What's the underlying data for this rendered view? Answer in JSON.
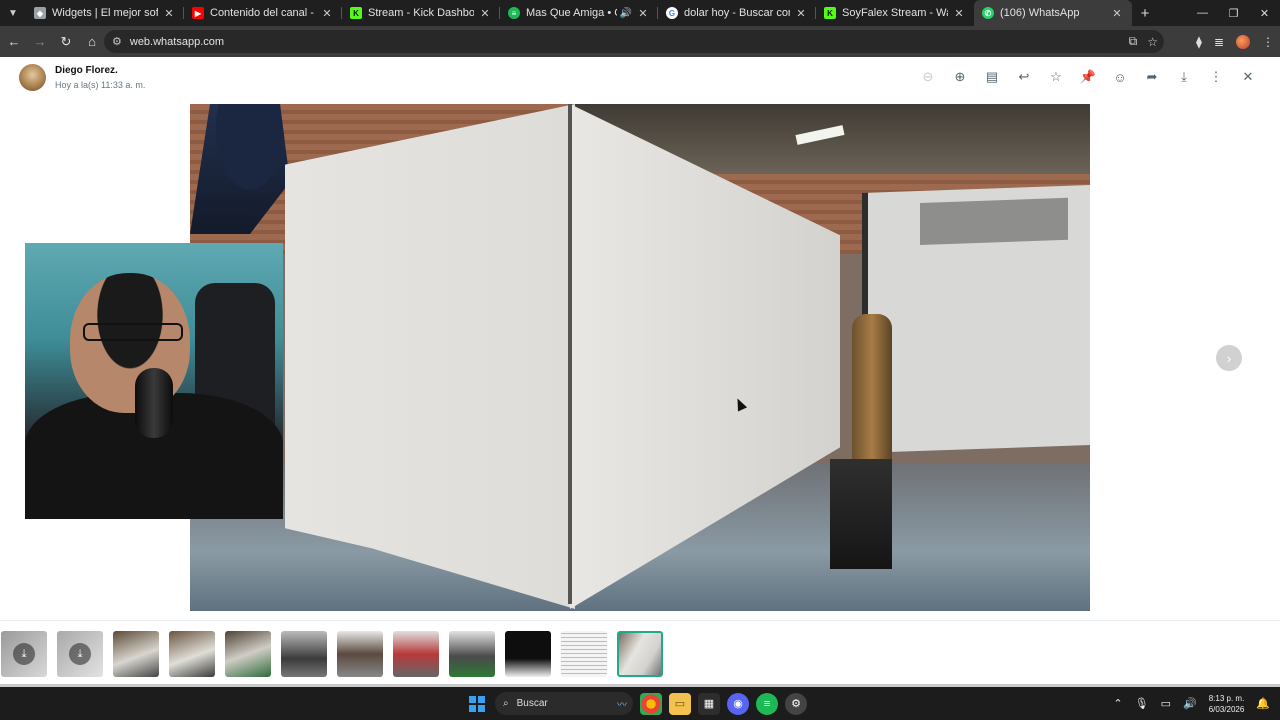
{
  "browser": {
    "tabs": [
      {
        "title": "Widgets | El mejor software para",
        "favicon": "widget-icon",
        "color": "#9aa0a6"
      },
      {
        "title": "Contenido del canal - YouTube Studio",
        "favicon": "youtube-icon",
        "color": "#ff0000"
      },
      {
        "title": "Stream - Kick Dashboard",
        "favicon": "kick-icon",
        "color": "#53fc18"
      },
      {
        "title": "Mas Que Amiga • Grupo Bryndis",
        "favicon": "spotify-icon",
        "color": "#1db954"
      },
      {
        "title": "dolar hoy - Buscar con Google",
        "favicon": "google-icon",
        "color": "#ffffff"
      },
      {
        "title": "SoyFalex Stream - Watch Live on Kick",
        "favicon": "kick-icon",
        "color": "#53fc18"
      },
      {
        "title": "(106) WhatsApp",
        "favicon": "whatsapp-icon",
        "color": "#25d366"
      }
    ],
    "active_tab": 6,
    "url": "web.whatsapp.com"
  },
  "viewer": {
    "sender": "Diego Florez.",
    "timestamp": "Hoy a la(s) 11:33 a. m.",
    "actions": [
      "zoom-out-icon",
      "zoom-in-icon",
      "caption-icon",
      "reply-icon",
      "star-icon",
      "pin-icon",
      "emoji-icon",
      "forward-icon",
      "download-icon",
      "more-icon",
      "close-icon"
    ],
    "media_description": "white truck box panel in welding workshop",
    "thumbnails": 12,
    "selected_thumbnail": 11
  },
  "taskbar": {
    "search_label": "Buscar",
    "time": "8:13 p. m.",
    "date": "6/03/2026"
  },
  "colors": {
    "accent": "#1faa8a",
    "chrome_bg": "#1f1f1f",
    "toolbar_bg": "#3c3c3c"
  }
}
